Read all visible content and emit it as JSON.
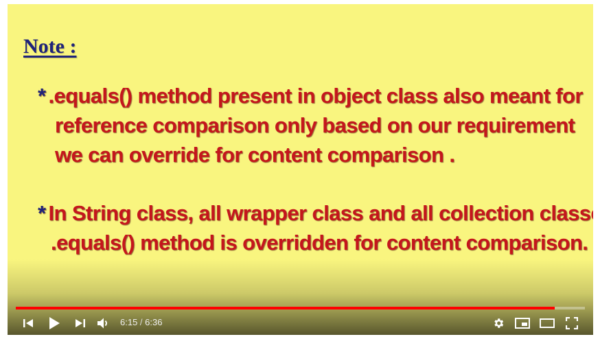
{
  "slide": {
    "title": "Note :",
    "bullets": [
      {
        "marker": "*",
        "lines": [
          ".equals() method present in object class also meant for",
          "reference comparison only based on our requirement",
          "we can override for content comparison ."
        ]
      },
      {
        "marker": "*",
        "lines": [
          "In String class, all wrapper class and all collection classes",
          ".equals() method is overridden for content comparison."
        ]
      }
    ]
  },
  "player": {
    "current_time": "6:15",
    "separator": " / ",
    "duration": "6:36",
    "progress_fraction": 0.947,
    "colors": {
      "background": "#f9f57f",
      "title": "#1f237a",
      "bullet_text": "#c4161c",
      "progress": "#ff0000"
    },
    "icons": {
      "previous": "skip-previous-icon",
      "play": "play-icon",
      "next": "skip-next-icon",
      "volume": "volume-icon",
      "settings": "gear-icon",
      "miniplayer": "miniplayer-icon",
      "theater": "theater-mode-icon",
      "fullscreen": "fullscreen-icon"
    }
  }
}
